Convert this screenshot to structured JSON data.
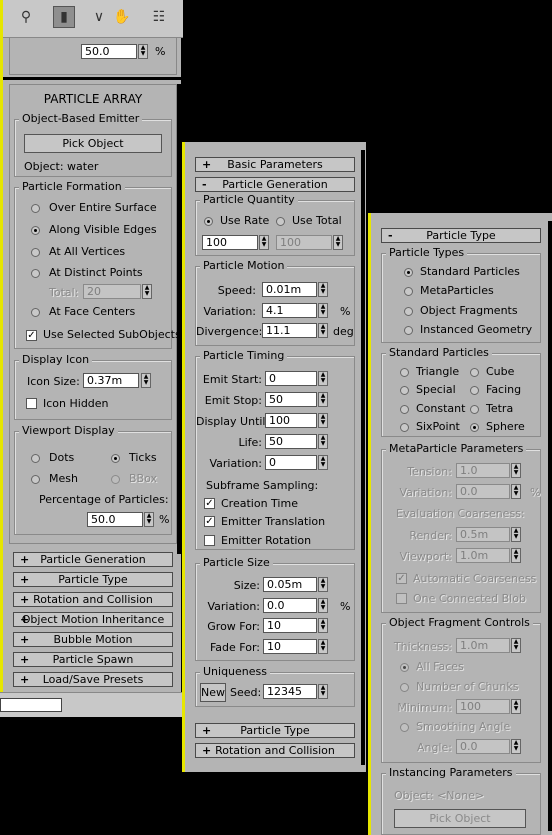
{
  "toolbar": {
    "icons": [
      "pin-icon",
      "pipe-icon",
      "vertex-icon",
      "hand-icon",
      "utility-icon"
    ]
  },
  "top_spinner": {
    "value": "50.0",
    "unit": "%"
  },
  "panel1": {
    "title": "PARTICLE ARRAY",
    "object_emitter": {
      "title": "Object-Based Emitter",
      "pick_button": "Pick Object",
      "object_label": "Object: water"
    },
    "formation": {
      "title": "Particle Formation",
      "options": [
        "Over Entire Surface",
        "Along Visible Edges",
        "At All Vertices",
        "At Distinct Points",
        "At Face Centers"
      ],
      "selected": "Along Visible Edges",
      "total_label": "Total:",
      "total_value": "20",
      "use_sub_label": "Use Selected SubObjects"
    },
    "display_icon": {
      "title": "Display Icon",
      "size_label": "Icon Size:",
      "size_value": "0.37m",
      "hidden_label": "Icon Hidden"
    },
    "viewport": {
      "title": "Viewport Display",
      "dots": "Dots",
      "ticks": "Ticks",
      "mesh": "Mesh",
      "bbox": "BBox",
      "pct_label": "Percentage of Particles:",
      "pct_value": "50.0",
      "unit": "%"
    },
    "rollouts": [
      "Particle Generation",
      "Particle Type",
      "Rotation and Collision",
      "Object Motion Inheritance",
      "Bubble Motion",
      "Particle Spawn",
      "Load/Save Presets"
    ]
  },
  "panel2": {
    "top_rollouts": [
      {
        "sign": "+",
        "label": "Basic Parameters"
      },
      {
        "sign": "-",
        "label": "Particle Generation"
      }
    ],
    "quantity": {
      "title": "Particle Quantity",
      "use_rate": "Use Rate",
      "use_total": "Use Total",
      "rate_value": "100",
      "total_value": "100"
    },
    "motion": {
      "title": "Particle Motion",
      "speed_label": "Speed:",
      "speed_value": "0.01m",
      "variation_label": "Variation:",
      "variation_value": "4.1",
      "variation_unit": "%",
      "divergence_label": "Divergence:",
      "divergence_value": "11.1",
      "divergence_unit": "deg"
    },
    "timing": {
      "title": "Particle Timing",
      "rows": [
        {
          "label": "Emit Start:",
          "value": "0"
        },
        {
          "label": "Emit Stop:",
          "value": "50"
        },
        {
          "label": "Display Until:",
          "value": "100"
        },
        {
          "label": "Life:",
          "value": "50"
        },
        {
          "label": "Variation:",
          "value": "0"
        }
      ],
      "subframe": "Subframe Sampling:",
      "creation_time": "Creation Time",
      "emitter_translation": "Emitter Translation",
      "emitter_rotation": "Emitter Rotation"
    },
    "size": {
      "title": "Particle Size",
      "size_label": "Size:",
      "size_value": "0.05m",
      "variation_label": "Variation:",
      "variation_value": "0.0",
      "variation_unit": "%",
      "grow_label": "Grow For:",
      "grow_value": "10",
      "fade_label": "Fade For:",
      "fade_value": "10"
    },
    "uniqueness": {
      "title": "Uniqueness",
      "new_button": "New",
      "seed_label": "Seed:",
      "seed_value": "12345"
    },
    "bottom_rollouts": [
      {
        "sign": "+",
        "label": "Particle Type"
      },
      {
        "sign": "+",
        "label": "Rotation and Collision"
      }
    ]
  },
  "panel3": {
    "rollout": {
      "sign": "-",
      "label": "Particle Type"
    },
    "types": {
      "title": "Particle Types",
      "options": [
        "Standard Particles",
        "MetaParticles",
        "Object Fragments",
        "Instanced Geometry"
      ],
      "selected": "Standard Particles"
    },
    "standard": {
      "title": "Standard Particles",
      "left": [
        "Triangle",
        "Special",
        "Constant",
        "SixPoint"
      ],
      "right": [
        "Cube",
        "Facing",
        "Tetra",
        "Sphere"
      ],
      "selected": "Sphere"
    },
    "meta": {
      "title": "MetaParticle Parameters",
      "tension_label": "Tension:",
      "tension_value": "1.0",
      "variation_label": "Variation:",
      "variation_value": "0.0",
      "unit": "%",
      "eval_label": "Evaluation Coarseness:",
      "render_label": "Render:",
      "render_value": "0.5m",
      "viewport_label": "Viewport:",
      "viewport_value": "1.0m",
      "auto_coarse": "Automatic Coarseness",
      "one_blob": "One Connected Blob"
    },
    "fragment": {
      "title": "Object Fragment Controls",
      "thickness_label": "Thickness:",
      "thickness_value": "1.0m",
      "all_faces": "All Faces",
      "num_chunks": "Number of Chunks",
      "minimum_label": "Minimum:",
      "minimum_value": "100",
      "smoothing": "Smoothing Angle",
      "angle_label": "Angle:",
      "angle_value": "0.0"
    },
    "instancing": {
      "title": "Instancing Parameters",
      "object_label": "Object: <None>",
      "pick_button": "Pick Object"
    }
  }
}
